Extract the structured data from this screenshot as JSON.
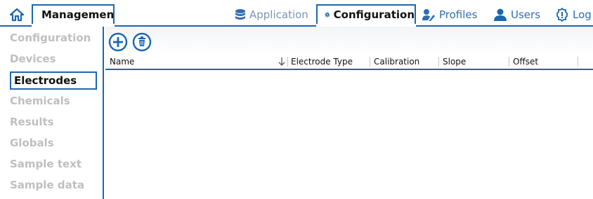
{
  "top_nav": {
    "management_label": "Management",
    "tabs": [
      {
        "label": "Application",
        "icon": "database-icon"
      },
      {
        "label": "Configuration",
        "icon": "gear-icon"
      },
      {
        "label": "Profiles",
        "icon": "user-edit-icon"
      },
      {
        "label": "Users",
        "icon": "user-icon"
      },
      {
        "label": "Log",
        "icon": "log-icon"
      }
    ]
  },
  "sidebar": {
    "items": [
      {
        "label": "Configuration"
      },
      {
        "label": "Devices"
      },
      {
        "label": "Electrodes",
        "active": true
      },
      {
        "label": "Chemicals"
      },
      {
        "label": "Results"
      },
      {
        "label": "Globals"
      },
      {
        "label": "Sample text"
      },
      {
        "label": "Sample data"
      }
    ]
  },
  "table": {
    "columns": [
      "Name",
      "Electrode Type",
      "Calibration",
      "Slope",
      "Offset"
    ],
    "rows": []
  },
  "colors": {
    "accent": "#1b67b2",
    "muted_nav": "#7d93b5",
    "inactive_sidebar": "#bfbfbf"
  }
}
